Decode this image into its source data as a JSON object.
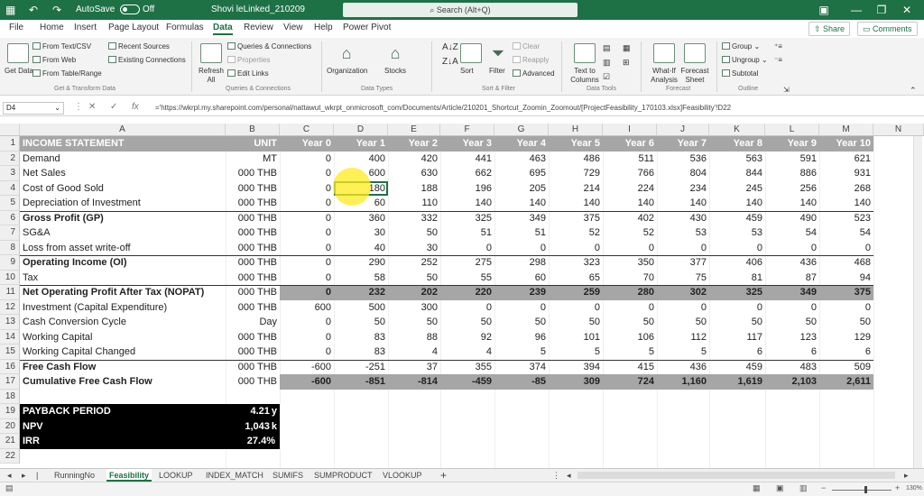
{
  "colors": {
    "accent": "#1e7145",
    "band_gray": "#a6a6a6",
    "band_black": "#000000",
    "cursor_highlight": "#ffeb1e"
  },
  "titlebar": {
    "autosave_label": "AutoSave",
    "autosave_state": "Off",
    "doc_title": "Shovi leLinked_210209",
    "search_placeholder": "Search (Alt+Q)",
    "icons": [
      "save-icon",
      "undo-icon",
      "redo-icon",
      "search-icon",
      "ribbon-display-icon",
      "minimize-icon",
      "restore-icon",
      "close-icon"
    ]
  },
  "menu": {
    "tabs": [
      "File",
      "Home",
      "Insert",
      "Page Layout",
      "Formulas",
      "Data",
      "Review",
      "View",
      "Help",
      "Power Pivot"
    ],
    "active_tab": "Data",
    "share_label": "Share",
    "comments_label": "Comments"
  },
  "ribbon": {
    "get_data": {
      "get_data_label": "Get Data",
      "from_text_csv": "From Text/CSV",
      "from_web": "From Web",
      "from_table": "From Table/Range",
      "recent_sources": "Recent Sources",
      "existing_connections": "Existing Connections",
      "group_label": "Get & Transform Data"
    },
    "queries": {
      "refresh_all": "Refresh All",
      "queries_connections": "Queries & Connections",
      "properties": "Properties",
      "edit_links": "Edit Links",
      "group_label": "Queries & Connections"
    },
    "data_types": {
      "organization": "Organization",
      "stocks": "Stocks",
      "group_label": "Data Types"
    },
    "sort_filter": {
      "sort": "Sort",
      "filter": "Filter",
      "clear": "Clear",
      "reapply": "Reapply",
      "advanced": "Advanced",
      "group_label": "Sort & Filter"
    },
    "data_tools": {
      "text_to_columns": "Text to Columns",
      "group_label": "Data Tools"
    },
    "forecast": {
      "what_if": "What-If Analysis",
      "forecast_sheet": "Forecast Sheet",
      "group_label": "Forecast"
    },
    "outline": {
      "group": "Group",
      "ungroup": "Ungroup",
      "subtotal": "Subtotal",
      "group_label": "Outline"
    }
  },
  "formula_bar": {
    "name_box": "D4",
    "fx_label": "fx",
    "formula": "='https://wkrpl.my.sharepoint.com/personal/nattawut_wkrpt_onmicrosoft_com/Documents/Article/210201_Shortcut_Zoomin_Zoomout/[ProjectFeasibility_170103.xlsx]Feasibility'!D22"
  },
  "grid": {
    "columns": [
      "A",
      "B",
      "C",
      "D",
      "E",
      "F",
      "G",
      "H",
      "I",
      "J",
      "K",
      "L",
      "M",
      "N"
    ],
    "selected_cell": "D4",
    "header_row": {
      "label": "INCOME STATEMENT",
      "unit": "UNIT",
      "years": [
        "Year 0",
        "Year 1",
        "Year 2",
        "Year 3",
        "Year 4",
        "Year 5",
        "Year 6",
        "Year 7",
        "Year 8",
        "Year 9",
        "Year 10"
      ]
    },
    "rows": [
      {
        "n": "2",
        "label": "Demand",
        "unit": "MT",
        "values": [
          "0",
          "400",
          "420",
          "441",
          "463",
          "486",
          "511",
          "536",
          "563",
          "591",
          "621"
        ],
        "bold": false
      },
      {
        "n": "3",
        "label": "Net Sales",
        "unit": "000 THB",
        "values": [
          "0",
          "600",
          "630",
          "662",
          "695",
          "729",
          "766",
          "804",
          "844",
          "886",
          "931"
        ],
        "bold": false
      },
      {
        "n": "4",
        "label": "Cost of Good Sold",
        "unit": "000 THB",
        "values": [
          "0",
          "180",
          "188",
          "196",
          "205",
          "214",
          "224",
          "234",
          "245",
          "256",
          "268"
        ],
        "bold": false
      },
      {
        "n": "5",
        "label": "Depreciation of Investment",
        "unit": "000 THB",
        "values": [
          "0",
          "60",
          "110",
          "140",
          "140",
          "140",
          "140",
          "140",
          "140",
          "140",
          "140"
        ],
        "bold": false
      },
      {
        "n": "6",
        "label": "Gross Profit (GP)",
        "unit": "000 THB",
        "values": [
          "0",
          "360",
          "332",
          "325",
          "349",
          "375",
          "402",
          "430",
          "459",
          "490",
          "523"
        ],
        "bold": true
      },
      {
        "n": "7",
        "label": "SG&A",
        "unit": "000 THB",
        "values": [
          "0",
          "30",
          "50",
          "51",
          "51",
          "52",
          "52",
          "53",
          "53",
          "54",
          "54"
        ],
        "bold": false
      },
      {
        "n": "8",
        "label": "Loss from asset write-off",
        "unit": "000 THB",
        "values": [
          "0",
          "40",
          "30",
          "0",
          "0",
          "0",
          "0",
          "0",
          "0",
          "0",
          "0"
        ],
        "bold": false
      },
      {
        "n": "9",
        "label": "Operating Income (OI)",
        "unit": "000 THB",
        "values": [
          "0",
          "290",
          "252",
          "275",
          "298",
          "323",
          "350",
          "377",
          "406",
          "436",
          "468"
        ],
        "bold": true
      },
      {
        "n": "10",
        "label": "Tax",
        "unit": "000 THB",
        "values": [
          "0",
          "58",
          "50",
          "55",
          "60",
          "65",
          "70",
          "75",
          "81",
          "87",
          "94"
        ],
        "bold": false
      },
      {
        "n": "11",
        "label": "Net Operating Profit After Tax (NOPAT)",
        "unit": "000 THB",
        "values": [
          "0",
          "232",
          "202",
          "220",
          "239",
          "259",
          "280",
          "302",
          "325",
          "349",
          "375"
        ],
        "bold": true
      },
      {
        "n": "12",
        "label": "Investment (Capital Expenditure)",
        "unit": "000 THB",
        "values": [
          "600",
          "500",
          "300",
          "0",
          "0",
          "0",
          "0",
          "0",
          "0",
          "0",
          "0"
        ],
        "bold": false
      },
      {
        "n": "13",
        "label": "Cash Conversion Cycle",
        "unit": "Day",
        "values": [
          "0",
          "50",
          "50",
          "50",
          "50",
          "50",
          "50",
          "50",
          "50",
          "50",
          "50"
        ],
        "bold": false
      },
      {
        "n": "14",
        "label": "Working Capital",
        "unit": "000 THB",
        "values": [
          "0",
          "83",
          "88",
          "92",
          "96",
          "101",
          "106",
          "112",
          "117",
          "123",
          "129"
        ],
        "bold": false
      },
      {
        "n": "15",
        "label": "Working Capital Changed",
        "unit": "000 THB",
        "values": [
          "0",
          "83",
          "4",
          "4",
          "5",
          "5",
          "5",
          "5",
          "6",
          "6",
          "6"
        ],
        "bold": false
      },
      {
        "n": "16",
        "label": "Free Cash Flow",
        "unit": "000 THB",
        "values": [
          "-600",
          "-251",
          "37",
          "355",
          "374",
          "394",
          "415",
          "436",
          "459",
          "483",
          "509"
        ],
        "bold": true
      },
      {
        "n": "17",
        "label": "Cumulative Free Cash Flow",
        "unit": "000 THB",
        "values": [
          "-600",
          "-851",
          "-814",
          "-459",
          "-85",
          "309",
          "724",
          "1,160",
          "1,619",
          "2,103",
          "2,611"
        ],
        "bold": true
      }
    ],
    "empty_rows": [
      "18",
      "22"
    ],
    "summary": [
      {
        "n": "19",
        "label": "PAYBACK PERIOD",
        "value": "4.21",
        "suffix": "y"
      },
      {
        "n": "20",
        "label": "NPV",
        "value": "1,043",
        "suffix": "k"
      },
      {
        "n": "21",
        "label": "IRR",
        "value": "27.4%",
        "suffix": ""
      }
    ]
  },
  "sheets": {
    "tabs": [
      "RunningNo",
      "Feasibility",
      "LOOKUP",
      "INDEX_MATCH",
      "SUMIFS",
      "SUMPRODUCT",
      "VLOOKUP"
    ],
    "active": "Feasibility",
    "add_sheet": "+"
  },
  "status": {
    "zoom": "130%"
  }
}
